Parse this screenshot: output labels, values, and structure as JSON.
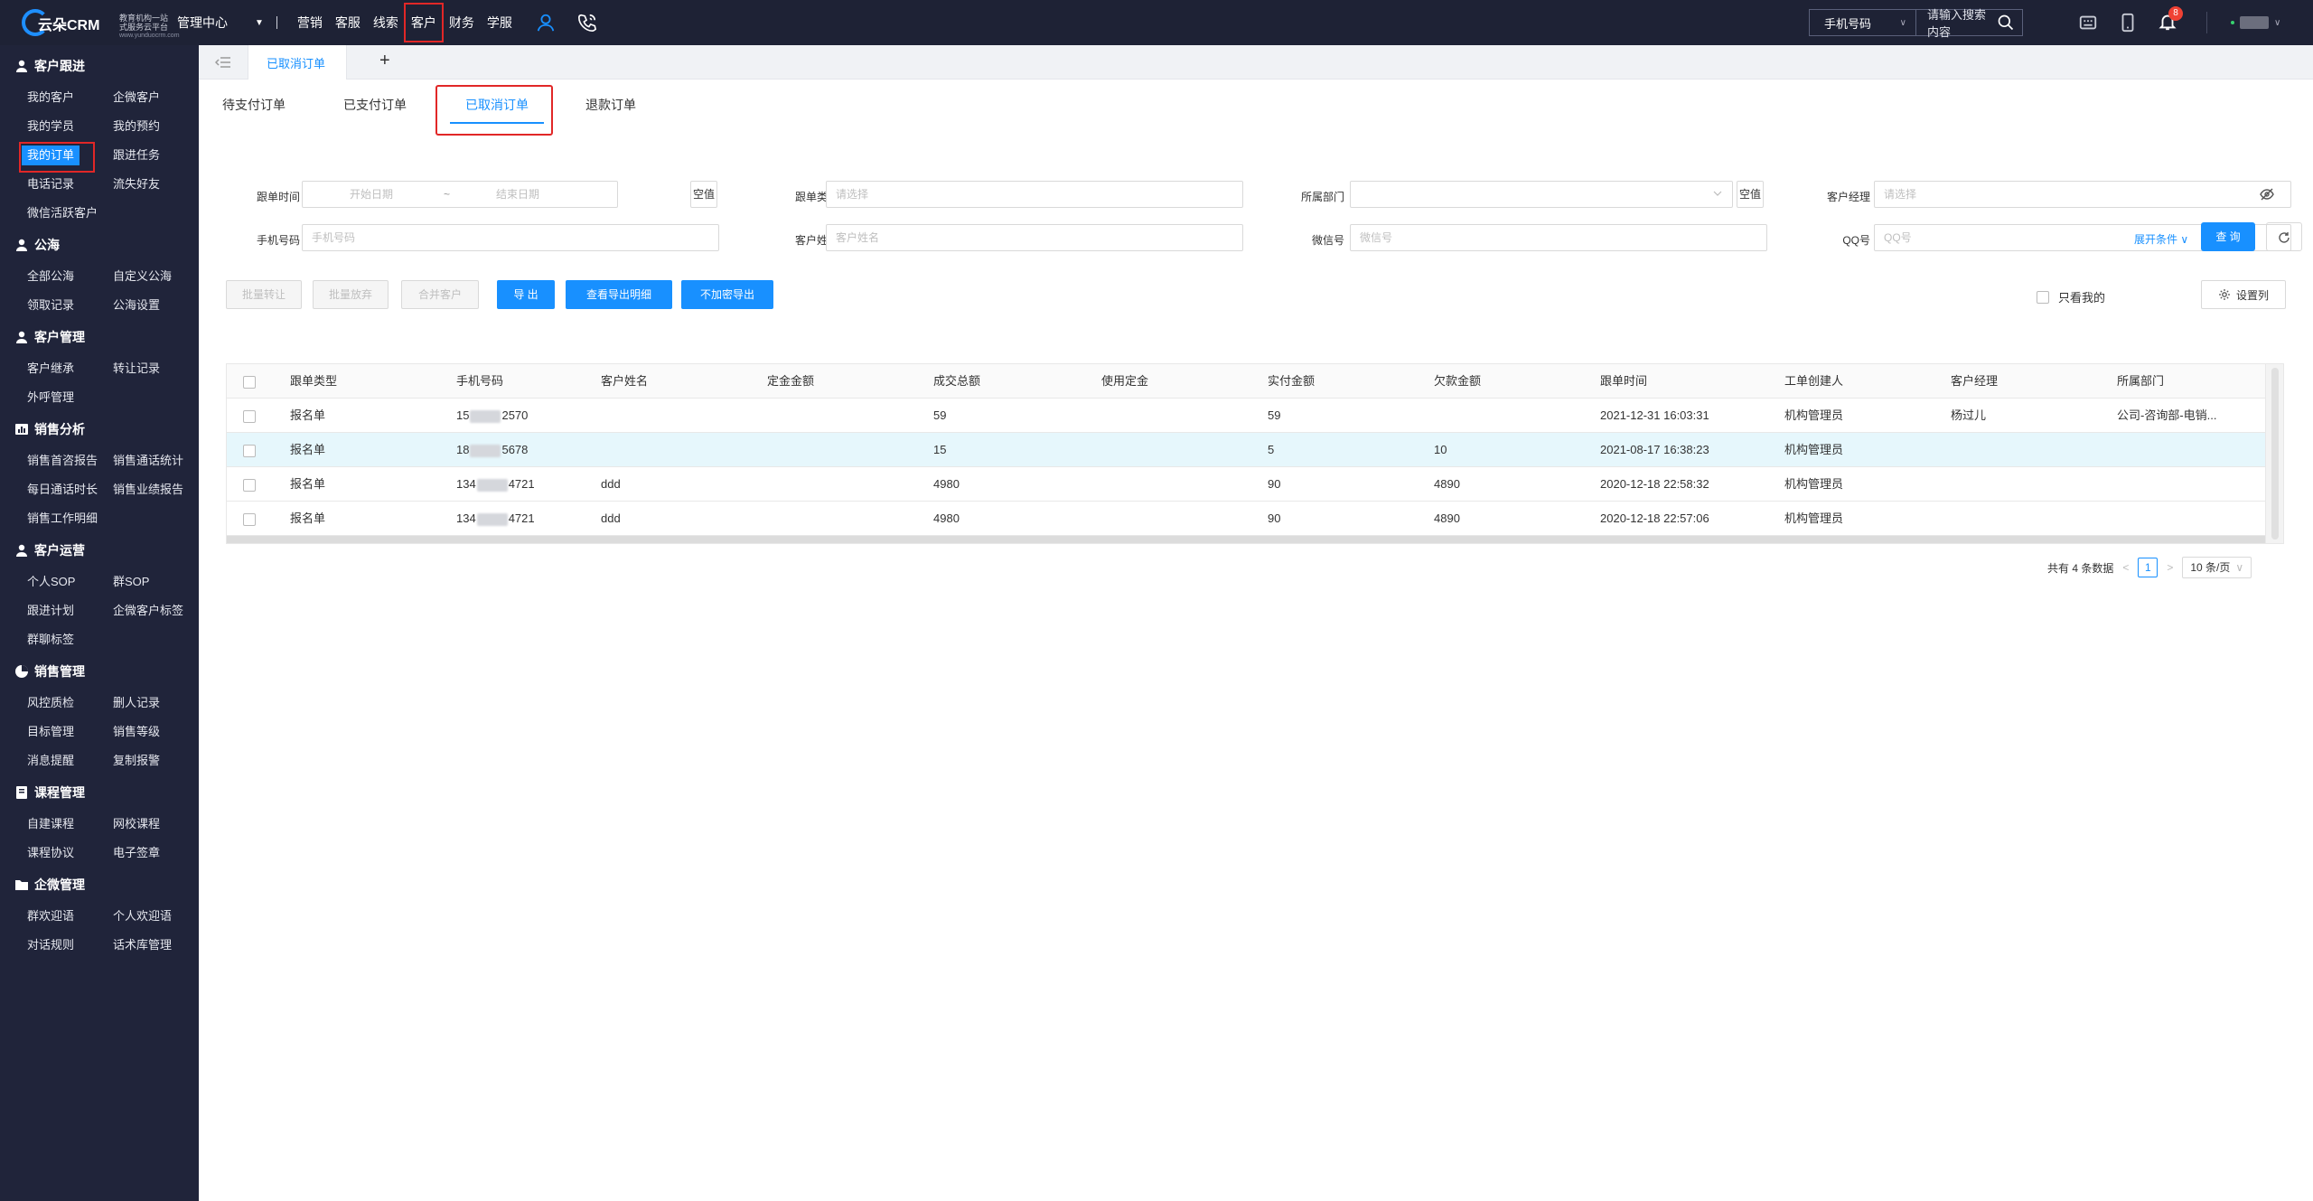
{
  "brand": {
    "name": "云朵CRM",
    "tagline_line1": "教育机构一站",
    "tagline_line2": "式服务云平台",
    "url": "www.yunduocrm.com"
  },
  "topnav": {
    "mgmt_label": "管理中心",
    "items": [
      "营销",
      "客服",
      "线索",
      "客户",
      "财务",
      "学服"
    ],
    "active_index": 3
  },
  "search": {
    "type_label": "手机号码",
    "placeholder": "请输入搜索内容"
  },
  "notifications": {
    "count": "8"
  },
  "sidebar": {
    "sections": [
      {
        "title": "客户跟进",
        "icon": "user-icon",
        "items": [
          "我的客户",
          "企微客户",
          "我的学员",
          "我的预约",
          "我的订单",
          "跟进任务",
          "电话记录",
          "流失好友",
          "微信活跃客户"
        ]
      },
      {
        "title": "公海",
        "icon": "user-icon",
        "items": [
          "全部公海",
          "自定义公海",
          "领取记录",
          "公海设置"
        ]
      },
      {
        "title": "客户管理",
        "icon": "user-icon",
        "items": [
          "客户继承",
          "转让记录",
          "外呼管理"
        ]
      },
      {
        "title": "销售分析",
        "icon": "chart-icon",
        "items": [
          "销售首咨报告",
          "销售通话统计",
          "每日通话时长",
          "销售业绩报告",
          "销售工作明细"
        ]
      },
      {
        "title": "客户运营",
        "icon": "user-icon",
        "items": [
          "个人SOP",
          "群SOP",
          "跟进计划",
          "企微客户标签",
          "群聊标签"
        ]
      },
      {
        "title": "销售管理",
        "icon": "chart-icon",
        "items": [
          "风控质检",
          "删人记录",
          "目标管理",
          "销售等级",
          "消息提醒",
          "复制报警"
        ]
      },
      {
        "title": "课程管理",
        "icon": "book-icon",
        "items": [
          "自建课程",
          "网校课程",
          "课程协议",
          "电子签章"
        ]
      },
      {
        "title": "企微管理",
        "icon": "folder-icon",
        "items": [
          "群欢迎语",
          "个人欢迎语",
          "对话规则",
          "话术库管理"
        ]
      }
    ],
    "active_item": "我的订单"
  },
  "page_tab": {
    "label": "已取消订单",
    "add": "+"
  },
  "subtabs": {
    "items": [
      "待支付订单",
      "已支付订单",
      "已取消订单",
      "退款订单"
    ],
    "active_index": 2
  },
  "filters": {
    "order_time_label": "跟单时间",
    "start_placeholder": "开始日期",
    "end_placeholder": "结束日期",
    "date_sep": "~",
    "clear_label": "空值",
    "order_type_label": "跟单类型",
    "order_type_placeholder": "请选择",
    "dept_label": "所属部门",
    "dept_clear_label": "空值",
    "manager_label": "客户经理",
    "manager_placeholder": "请选择",
    "phone_label": "手机号码",
    "phone_placeholder": "手机号码",
    "name_label": "客户姓名",
    "name_placeholder": "客户姓名",
    "wechat_label": "微信号",
    "wechat_placeholder": "微信号",
    "qq_label": "QQ号",
    "qq_placeholder": "QQ号",
    "expand_label": "展开条件",
    "query_label": "查 询"
  },
  "actions": {
    "batch_transfer": "批量转让",
    "batch_abandon": "批量放弃",
    "merge": "合并客户",
    "export": "导 出",
    "export_detail": "查看导出明细",
    "export_plain": "不加密导出",
    "only_mine": "只看我的",
    "set_columns": "设置列"
  },
  "table": {
    "headers": [
      "跟单类型",
      "手机号码",
      "客户姓名",
      "定金金额",
      "成交总额",
      "使用定金",
      "实付金额",
      "欠款金额",
      "跟单时间",
      "工单创建人",
      "客户经理",
      "所属部门"
    ],
    "rows": [
      {
        "type": "报名单",
        "phone_a": "15",
        "phone_b": "2570",
        "name": "",
        "deposit": "",
        "total": "59",
        "used_deposit": "",
        "paid": "59",
        "owed": "",
        "time": "2021-12-31 16:03:31",
        "creator": "机构管理员",
        "manager": "杨过儿",
        "dept": "公司-咨询部-电销..."
      },
      {
        "type": "报名单",
        "phone_a": "18",
        "phone_b": "5678",
        "name": "",
        "deposit": "",
        "total": "15",
        "used_deposit": "",
        "paid": "5",
        "owed": "10",
        "time": "2021-08-17 16:38:23",
        "creator": "机构管理员",
        "manager": "",
        "dept": ""
      },
      {
        "type": "报名单",
        "phone_a": "134",
        "phone_b": "4721",
        "name": "ddd",
        "deposit": "",
        "total": "4980",
        "used_deposit": "",
        "paid": "90",
        "owed": "4890",
        "time": "2020-12-18 22:58:32",
        "creator": "机构管理员",
        "manager": "",
        "dept": ""
      },
      {
        "type": "报名单",
        "phone_a": "134",
        "phone_b": "4721",
        "name": "ddd",
        "deposit": "",
        "total": "4980",
        "used_deposit": "",
        "paid": "90",
        "owed": "4890",
        "time": "2020-12-18 22:57:06",
        "creator": "机构管理员",
        "manager": "",
        "dept": ""
      }
    ],
    "highlighted_row": 1
  },
  "pager": {
    "total_text": "共有 4 条数据",
    "prev": "<",
    "page": "1",
    "next": ">",
    "page_size": "10 条/页"
  },
  "colors": {
    "accent": "#1890ff",
    "topbar": "#1e2235",
    "sidebar": "#20243a",
    "highlight_box": "#e12727"
  }
}
